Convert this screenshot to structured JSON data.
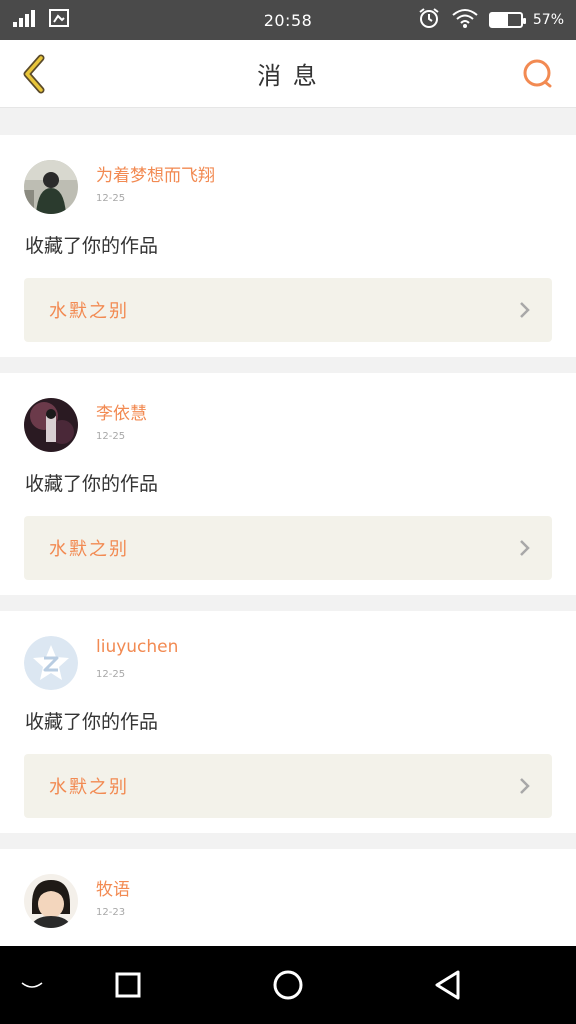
{
  "status_bar": {
    "time": "20:58",
    "battery_percent": "57",
    "battery_level": 0.57
  },
  "header": {
    "title": "消 息",
    "accent_color": "#f28a52"
  },
  "messages": [
    {
      "username": "为着梦想而飞翔",
      "date": "12-25",
      "action": "收藏了你的作品",
      "work_title": "水默之别"
    },
    {
      "username": "李依慧",
      "date": "12-25",
      "action": "收藏了你的作品",
      "work_title": "水默之别"
    },
    {
      "username": "liuyuchen",
      "date": "12-25",
      "action": "收藏了你的作品",
      "work_title": "水默之别"
    },
    {
      "username": "牧语",
      "date": "12-23",
      "action": "",
      "work_title": ""
    }
  ]
}
